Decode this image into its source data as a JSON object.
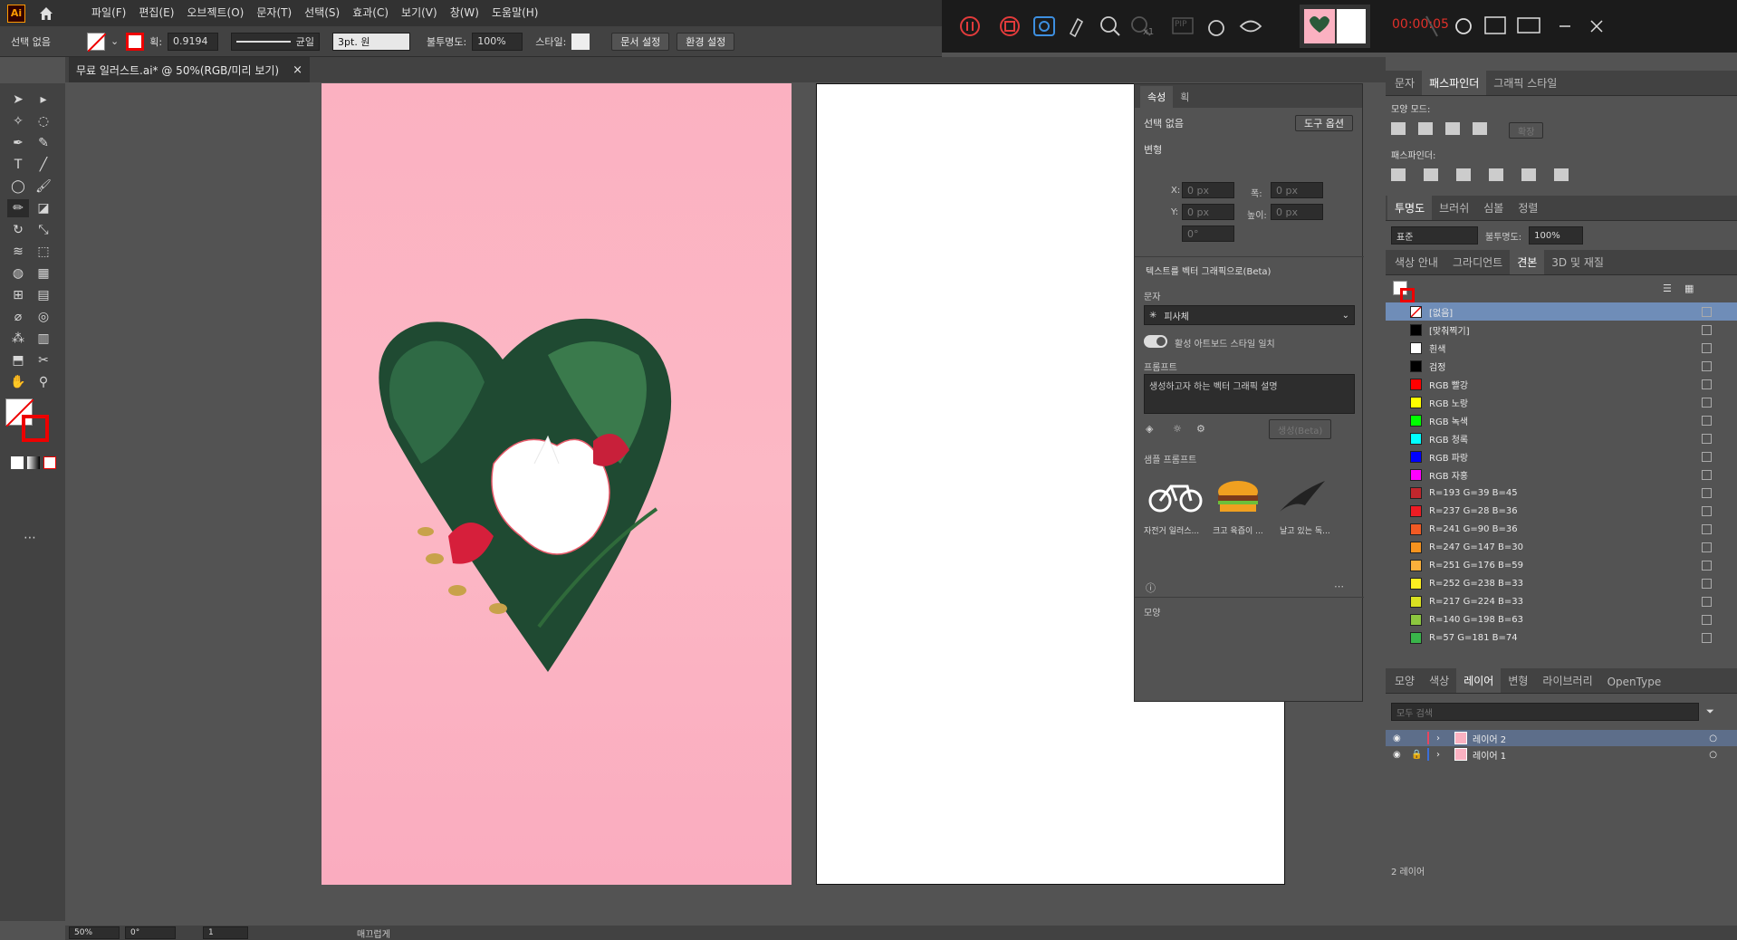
{
  "menubar": {
    "logo": "Ai",
    "items": [
      "파일(F)",
      "편집(E)",
      "오브젝트(O)",
      "문자(T)",
      "선택(S)",
      "효과(C)",
      "보기(V)",
      "창(W)",
      "도움말(H)"
    ]
  },
  "recorder": {
    "time": "00:00:05",
    "zoom_label": "x1",
    "pip": "PIP"
  },
  "control": {
    "selection": "선택 없음",
    "stroke_label": "획:",
    "stroke_value": "0.9194",
    "line_style": "균일",
    "brush": "3pt. 원",
    "opacity_label": "불투명도:",
    "opacity_value": "100%",
    "style_label": "스타일:",
    "doc_setup": "문서 설정",
    "prefs": "환경 설정"
  },
  "document": {
    "tab_title": "무료 일러스트.ai* @ 50%(RGB/미리 보기)"
  },
  "properties": {
    "tab1": "속성",
    "tab2": "획",
    "no_selection": "선택 없음",
    "tool_options": "도구 옵션",
    "transform": "변형",
    "x_label": "X:",
    "y_label": "Y:",
    "w_label": "폭:",
    "h_label": "높이:",
    "x_val": "0 px",
    "y_val": "0 px",
    "w_val": "0 px",
    "h_val": "0 px",
    "angle_val": "0°",
    "tvg_title": "텍스트를 벡터 그래픽으로(Beta)",
    "type_label": "문자",
    "type_value": "피사체",
    "match_label": "활성 아트보드 스타일 일치",
    "prompt_label": "프롬프트",
    "prompt_placeholder": "생성하고자 하는 벡터 그래픽 설명",
    "generate": "생성(Beta)",
    "samples_label": "샘플 프롬프트",
    "sample1": "자전거 일러스...",
    "sample2": "크고 육즙이 ...",
    "sample3": "날고 있는 독...",
    "appearance": "모양"
  },
  "pathfinder": {
    "tabs": [
      "문자",
      "패스파인더",
      "그래픽 스타일"
    ],
    "shape_modes": "모양 모드:",
    "expand": "확장",
    "pathfinders": "패스파인더:"
  },
  "transparency": {
    "tabs": [
      "투명도",
      "브러쉬",
      "심볼",
      "정렬"
    ],
    "mode": "표준",
    "opacity_label": "불투명도:",
    "opacity": "100%"
  },
  "swatches": {
    "tabs": [
      "색상 안내",
      "그라디언트",
      "견본",
      "3D 및 재질"
    ],
    "items": [
      {
        "name": "[없음]",
        "color": "#ffffff"
      },
      {
        "name": "[맞춰찍기]",
        "color": "#000000"
      },
      {
        "name": "흰색",
        "color": "#ffffff"
      },
      {
        "name": "검정",
        "color": "#000000"
      },
      {
        "name": "RGB 빨강",
        "color": "#ff0000"
      },
      {
        "name": "RGB 노랑",
        "color": "#ffff00"
      },
      {
        "name": "RGB 녹색",
        "color": "#00ff00"
      },
      {
        "name": "RGB 청록",
        "color": "#00ffff"
      },
      {
        "name": "RGB 파랑",
        "color": "#0000ff"
      },
      {
        "name": "RGB 자홍",
        "color": "#ff00ff"
      },
      {
        "name": "R=193 G=39 B=45",
        "color": "#c1272d"
      },
      {
        "name": "R=237 G=28 B=36",
        "color": "#ed1c24"
      },
      {
        "name": "R=241 G=90 B=36",
        "color": "#f15a24"
      },
      {
        "name": "R=247 G=147 B=30",
        "color": "#f7931e"
      },
      {
        "name": "R=251 G=176 B=59",
        "color": "#fbb03b"
      },
      {
        "name": "R=252 G=238 B=33",
        "color": "#fcee21"
      },
      {
        "name": "R=217 G=224 B=33",
        "color": "#d9e021"
      },
      {
        "name": "R=140 G=198 B=63",
        "color": "#8cc63f"
      },
      {
        "name": "R=57 G=181 B=74",
        "color": "#39b54a"
      }
    ]
  },
  "layers": {
    "tabs": [
      "모양",
      "색상",
      "레이어",
      "변형",
      "라이브러리",
      "OpenType"
    ],
    "search_placeholder": "모두 검색",
    "items": [
      "레이어 2",
      "레이어 1"
    ],
    "count": "2 레이어"
  },
  "status": {
    "zoom": "50%",
    "rotation": "0°",
    "artboard": "1",
    "mode": "매끄럽게"
  }
}
